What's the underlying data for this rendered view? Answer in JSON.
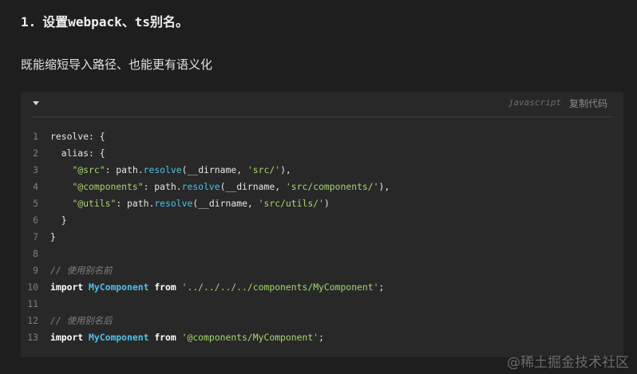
{
  "heading": {
    "number": "1.",
    "prefix": "设置",
    "tool1": "webpack",
    "sep": "、",
    "tool2": "ts",
    "suffix": "别名。"
  },
  "paragraph": "既能缩短导入路径、也能更有语义化",
  "code_block": {
    "language": "javascript",
    "copy_label": "复制代码",
    "lines": [
      {
        "n": "1",
        "tokens": [
          {
            "t": "resolve: {",
            "c": "plain"
          }
        ]
      },
      {
        "n": "2",
        "tokens": [
          {
            "t": "  alias: {",
            "c": "plain"
          }
        ]
      },
      {
        "n": "3",
        "tokens": [
          {
            "t": "    ",
            "c": "plain"
          },
          {
            "t": "\"@src\"",
            "c": "str"
          },
          {
            "t": ": path.",
            "c": "plain"
          },
          {
            "t": "resolve",
            "c": "fn"
          },
          {
            "t": "(__dirname, ",
            "c": "plain"
          },
          {
            "t": "'src/'",
            "c": "str"
          },
          {
            "t": "),",
            "c": "plain"
          }
        ]
      },
      {
        "n": "4",
        "tokens": [
          {
            "t": "    ",
            "c": "plain"
          },
          {
            "t": "\"@components\"",
            "c": "str"
          },
          {
            "t": ": path.",
            "c": "plain"
          },
          {
            "t": "resolve",
            "c": "fn"
          },
          {
            "t": "(__dirname, ",
            "c": "plain"
          },
          {
            "t": "'src/components/'",
            "c": "str"
          },
          {
            "t": "),",
            "c": "plain"
          }
        ]
      },
      {
        "n": "5",
        "tokens": [
          {
            "t": "    ",
            "c": "plain"
          },
          {
            "t": "\"@utils\"",
            "c": "str"
          },
          {
            "t": ": path.",
            "c": "plain"
          },
          {
            "t": "resolve",
            "c": "fn"
          },
          {
            "t": "(__dirname, ",
            "c": "plain"
          },
          {
            "t": "'src/utils/'",
            "c": "str"
          },
          {
            "t": ")",
            "c": "plain"
          }
        ]
      },
      {
        "n": "6",
        "tokens": [
          {
            "t": "  }",
            "c": "plain"
          }
        ]
      },
      {
        "n": "7",
        "tokens": [
          {
            "t": "}",
            "c": "plain"
          }
        ]
      },
      {
        "n": "8",
        "tokens": []
      },
      {
        "n": "9",
        "tokens": [
          {
            "t": "// 使用别名前",
            "c": "comment"
          }
        ]
      },
      {
        "n": "10",
        "tokens": [
          {
            "t": "import",
            "c": "kw"
          },
          {
            "t": " ",
            "c": "plain"
          },
          {
            "t": "MyComponent",
            "c": "cls"
          },
          {
            "t": " ",
            "c": "plain"
          },
          {
            "t": "from",
            "c": "kw"
          },
          {
            "t": " ",
            "c": "plain"
          },
          {
            "t": "'../../../../components/MyComponent'",
            "c": "str"
          },
          {
            "t": ";",
            "c": "plain"
          }
        ]
      },
      {
        "n": "11",
        "tokens": []
      },
      {
        "n": "12",
        "tokens": [
          {
            "t": "// 使用别名后",
            "c": "comment"
          }
        ]
      },
      {
        "n": "13",
        "tokens": [
          {
            "t": "import",
            "c": "kw"
          },
          {
            "t": " ",
            "c": "plain"
          },
          {
            "t": "MyComponent",
            "c": "cls"
          },
          {
            "t": " ",
            "c": "plain"
          },
          {
            "t": "from",
            "c": "kw"
          },
          {
            "t": " ",
            "c": "plain"
          },
          {
            "t": "'@components/MyComponent'",
            "c": "str"
          },
          {
            "t": ";",
            "c": "plain"
          }
        ]
      }
    ]
  },
  "watermark": "@稀土掘金技术社区",
  "icons": {
    "collapse": "caret-down-icon"
  },
  "colors": {
    "background": "#1e1e1e",
    "code_background": "#282828",
    "string": "#a5d86e",
    "function": "#4fc1e9",
    "comment": "#808080"
  }
}
